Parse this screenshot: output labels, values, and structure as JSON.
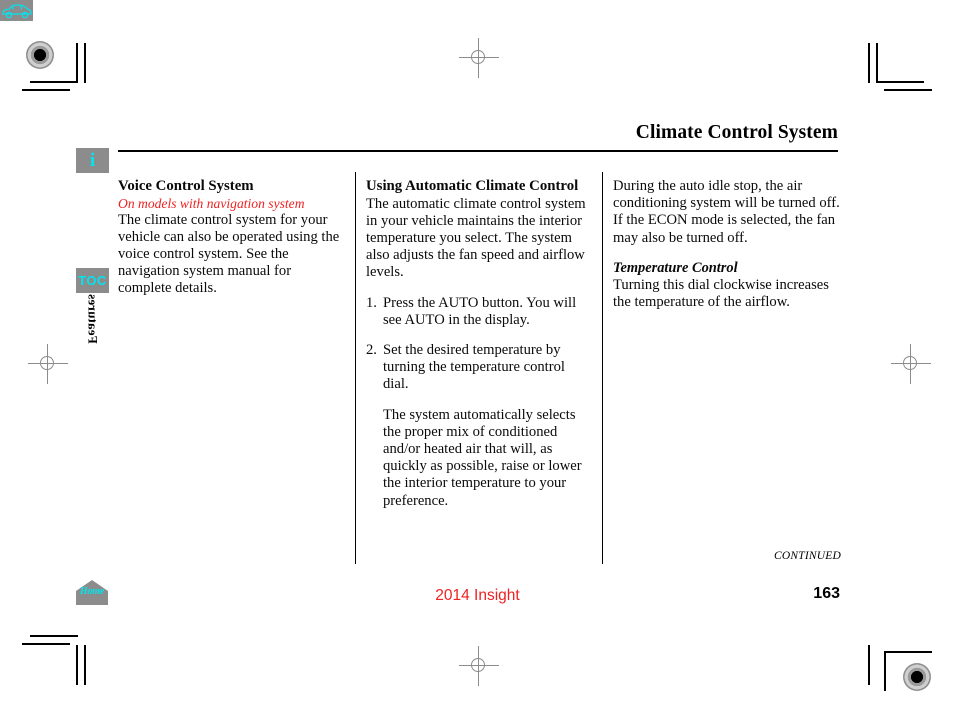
{
  "header": {
    "title": "Climate Control System"
  },
  "sidebar": {
    "items": [
      {
        "name": "info",
        "label": "i",
        "icon": "info-icon"
      },
      {
        "name": "vehicle",
        "label": "",
        "icon": "car-icon"
      },
      {
        "name": "toc",
        "label": "TOC",
        "icon": "toc-icon"
      },
      {
        "name": "features",
        "label": "Features",
        "icon": "features-tab"
      },
      {
        "name": "home",
        "label": "Home",
        "icon": "home-icon"
      }
    ]
  },
  "columns": {
    "left": {
      "heading": "Voice Control System",
      "note": "On models with navigation system",
      "body": "The climate control system for your vehicle can also be operated using the voice control system. See the navigation system manual for complete details."
    },
    "middle": {
      "heading": "Using Automatic Climate Control",
      "intro": "The automatic climate control system in your vehicle maintains the interior temperature you select. The system also adjusts the fan speed and airflow levels.",
      "steps": [
        {
          "num": "1.",
          "text": "Press the AUTO button. You will see AUTO in the display."
        },
        {
          "num": "2.",
          "text": "Set the desired temperature by turning the temperature control dial."
        }
      ],
      "step_note": "The system automatically selects the proper mix of conditioned and/or heated air that will, as quickly as possible, raise or lower the interior temperature to your preference."
    },
    "right": {
      "para1": "During the auto idle stop, the air conditioning system will be turned off. If the ECON mode is selected, the fan may also be turned off.",
      "heading": "Temperature Control",
      "para2": "Turning this dial clockwise increases the temperature of the airflow."
    }
  },
  "footer": {
    "continued": "CONTINUED",
    "model": "2014 Insight",
    "page_number": "163"
  },
  "colors": {
    "accent_red": "#ee2222",
    "icon_cyan": "#00e5ee",
    "icon_gray": "#8c8c8c"
  }
}
